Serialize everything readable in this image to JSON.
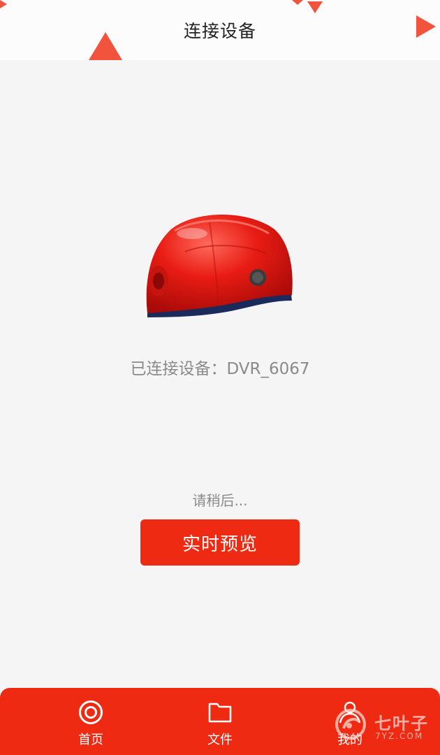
{
  "header": {
    "title": "连接设备"
  },
  "device": {
    "image_icon": "helmet-camera-image",
    "connected_label": "已连接设备：DVR_6067"
  },
  "status": {
    "wait_text": "请稍后..."
  },
  "actions": {
    "preview_label": "实时预览"
  },
  "tabbar": {
    "items": [
      {
        "label": "首页",
        "icon": "home-target-icon"
      },
      {
        "label": "文件",
        "icon": "folder-icon"
      },
      {
        "label": "我的",
        "icon": "user-icon"
      }
    ]
  },
  "watermark": {
    "name": "七叶子",
    "url": "7YZ.COM"
  },
  "colors": {
    "accent": "#ee2a12",
    "decoration": "#f2533d",
    "background": "#f5f5f5",
    "header_bg": "#fcfcfc",
    "muted_text": "#8a8a8a"
  }
}
